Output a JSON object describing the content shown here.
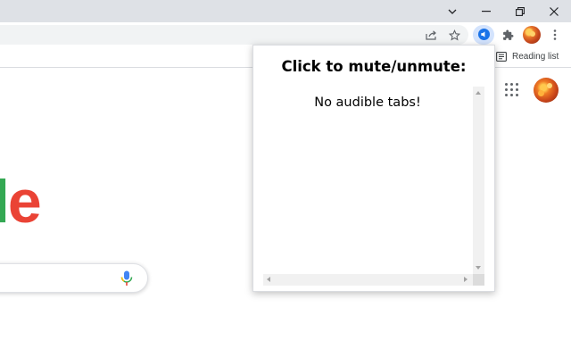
{
  "browser": {
    "window_controls": [
      "chevron-down-icon",
      "minimize-icon",
      "restore-icon",
      "close-icon"
    ],
    "toolbar_icons": [
      "share-icon",
      "star-icon",
      "audio-extension-icon",
      "puzzle-icon",
      "profile-avatar",
      "more-vert-icon"
    ],
    "bookmarks_bar": {
      "reading_list_label": "Reading list",
      "reading_list_icon": "reading-list-icon"
    }
  },
  "page": {
    "logo_partial": {
      "letters": [
        "l",
        "e"
      ],
      "colors": [
        "#34a853",
        "#ea4335"
      ]
    },
    "search_box": {
      "icon": "mic-icon"
    },
    "header_icons": [
      "apps-grid-icon",
      "profile-avatar"
    ]
  },
  "popup": {
    "title": "Click to mute/unmute:",
    "empty_message": "No audible tabs!"
  },
  "colors": {
    "titlebar": "#dee1e6",
    "extension_active_bg": "#d3e3fd",
    "extension_accent": "#1a73e8"
  }
}
